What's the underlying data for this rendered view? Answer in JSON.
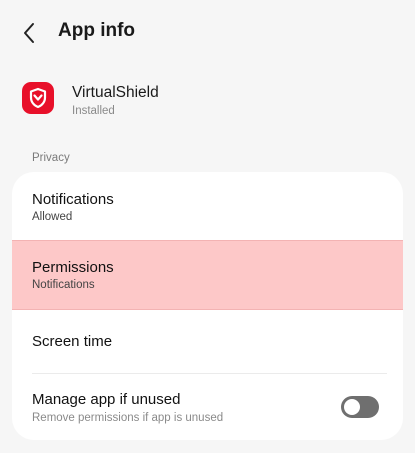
{
  "header": {
    "title": "App info",
    "back_icon": "chevron-left-icon"
  },
  "app": {
    "name": "VirtualShield",
    "status": "Installed",
    "icon": "shield-icon",
    "icon_color": "#e8102a"
  },
  "section": {
    "label": "Privacy"
  },
  "settings": {
    "notifications": {
      "title": "Notifications",
      "subtitle": "Allowed"
    },
    "permissions": {
      "title": "Permissions",
      "subtitle": "Notifications",
      "highlight_color": "#fdc8c8"
    },
    "screen_time": {
      "title": "Screen time"
    },
    "manage_unused": {
      "title": "Manage app if unused",
      "subtitle": "Remove permissions if app is unused",
      "toggle_on": false
    }
  }
}
